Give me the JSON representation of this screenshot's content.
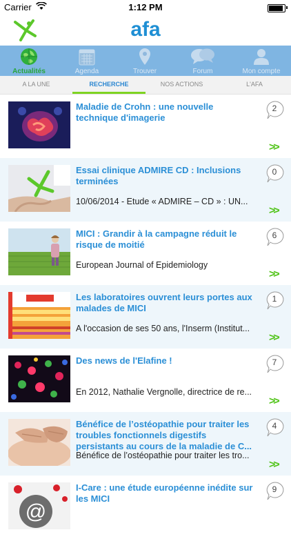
{
  "status_bar": {
    "carrier": "Carrier",
    "time": "1:12 PM"
  },
  "header": {
    "logo_text": "afa",
    "brand_color": "#1f8fd4"
  },
  "tabs": [
    {
      "label": "Actualités",
      "icon": "globe-icon",
      "active": true
    },
    {
      "label": "Agenda",
      "icon": "calendar-icon",
      "active": false
    },
    {
      "label": "Trouver",
      "icon": "location-pin-icon",
      "active": false
    },
    {
      "label": "Forum",
      "icon": "chat-bubbles-icon",
      "active": false
    },
    {
      "label": "Mon compte",
      "icon": "user-icon",
      "active": false
    }
  ],
  "subtabs": [
    {
      "label": "A LA UNE",
      "active": false
    },
    {
      "label": "RECHERCHE",
      "active": true
    },
    {
      "label": "NOS ACTIONS",
      "active": false
    },
    {
      "label": "L'AFA",
      "active": false
    }
  ],
  "articles": [
    {
      "title": "Maladie de Crohn : une nouvelle technique d'imagerie",
      "subtitle": "",
      "comments": "2",
      "thumb": "intestine-scan-image"
    },
    {
      "title": "Essai clinique ADMIRE CD : Inclusions terminées",
      "subtitle": "10/06/2014 - Etude « ADMIRE – CD » : UN...",
      "comments": "0",
      "thumb": "hand-with-figure-image"
    },
    {
      "title": "MICI : Grandir à la campagne réduit le risque de moitié",
      "subtitle": "European Journal of Epidemiology",
      "comments": "6",
      "thumb": "child-in-field-image"
    },
    {
      "title": "Les laboratoires ouvrent leurs portes aux malades de MICI",
      "subtitle": "A l'occasion de ses 50 ans, l'Inserm (Institut...",
      "comments": "1",
      "thumb": "inserm-poster-image"
    },
    {
      "title": "Des news de l'Elafine !",
      "subtitle": "En 2012, Nathalie Vergnolle, directrice de re...",
      "comments": "7",
      "thumb": "microscope-cells-image"
    },
    {
      "title": "Bénéfice de l’ostéopathie pour traiter les troubles fonctionnels digestifs persistants au cours de la maladie de C...",
      "subtitle": "Bénéfice de l’ostéopathie pour traiter les tro...",
      "comments": "4",
      "thumb": "osteopathy-hands-image"
    },
    {
      "title": "I-Care : une étude européenne inédite sur les MICI",
      "subtitle": "",
      "comments": "9",
      "thumb": "email-at-sign-image"
    }
  ],
  "chevron_text": ">>"
}
